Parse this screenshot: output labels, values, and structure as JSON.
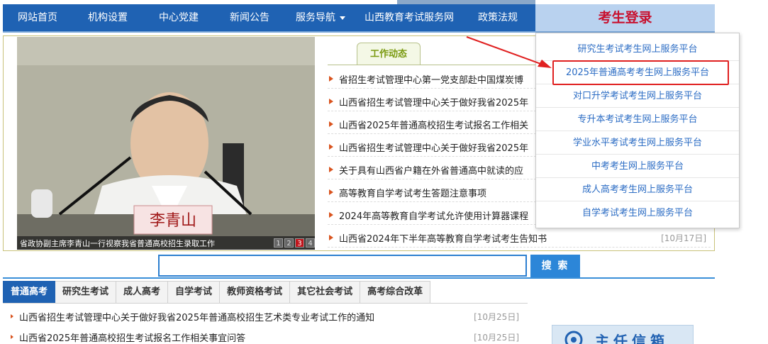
{
  "nav": {
    "items": [
      "网站首页",
      "机构设置",
      "中心党建",
      "新闻公告",
      "服务导航",
      "山西教育考试服务网",
      "政策法规"
    ],
    "login_label": "考生登录"
  },
  "photo": {
    "nameplate": "李青山",
    "caption": "省政协副主席李青山一行视察我省普通高校招生录取工作",
    "pages": [
      "1",
      "2",
      "3",
      "4"
    ]
  },
  "news": {
    "tab_label": "工作动态",
    "items": [
      {
        "title": "省招生考试管理中心第一党支部赴中国煤炭博",
        "date": ""
      },
      {
        "title": "山西省招生考试管理中心关于做好我省2025年",
        "date": ""
      },
      {
        "title": "山西省2025年普通高校招生考试报名工作相关",
        "date": ""
      },
      {
        "title": "山西省招生考试管理中心关于做好我省2025年",
        "date": ""
      },
      {
        "title": "关于具有山西省户籍在外省普通高中就读的应",
        "date": ""
      },
      {
        "title": "高等教育自学考试考生答题注意事项",
        "date": ""
      },
      {
        "title": "2024年高等教育自学考试允许使用计算器课程",
        "date": ""
      },
      {
        "title": "山西省2024年下半年高等教育自学考试考生告知书",
        "date": "[10月17日]"
      }
    ]
  },
  "dropdown": {
    "items": [
      "研究生考试考生网上服务平台",
      "2025年普通高考考生网上服务平台",
      "对口升学考试考生网上服务平台",
      "专升本考试考生网上服务平台",
      "学业水平考试考生网上服务平台",
      "中考考生网上服务平台",
      "成人高考考生网上服务平台",
      "自学考试考生网上服务平台"
    ],
    "highlight_color": "#e02020"
  },
  "search": {
    "value": "",
    "button_label": "搜 索"
  },
  "bottom_tabs": {
    "items": [
      "普通高考",
      "研究生考试",
      "成人高考",
      "自学考试",
      "教师资格考试",
      "其它社会考试",
      "高考综合改革"
    ]
  },
  "bottom_news": [
    {
      "title": "山西省招生考试管理中心关于做好我省2025年普通高校招生艺术类专业考试工作的通知",
      "date": "[10月25日]"
    },
    {
      "title": "山西省2025年普通高校招生考试报名工作相关事宜问答",
      "date": "[10月25日]"
    }
  ],
  "ad": {
    "text": "主任信箱"
  },
  "colors": {
    "nav_bg": "#1f62b3",
    "login_text": "#c8102e",
    "link_blue": "#2b6cc4"
  }
}
